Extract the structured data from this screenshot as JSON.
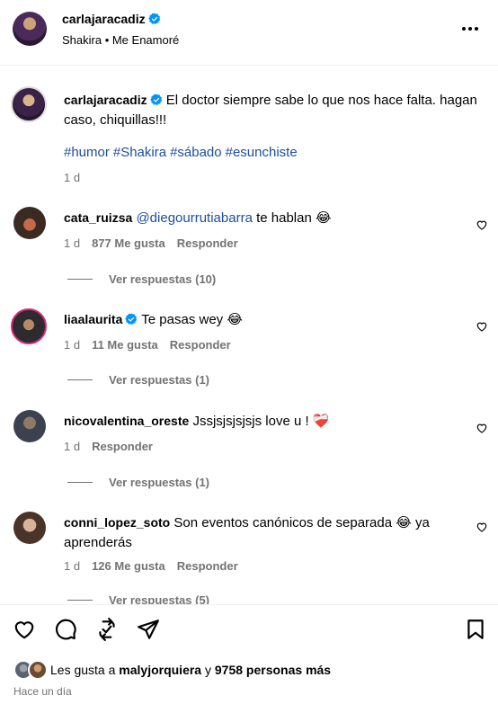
{
  "header": {
    "username": "carlajaracadiz",
    "song": "Shakira • Me Enamoré"
  },
  "caption": {
    "username": "carlajaracadiz",
    "text": "El doctor siempre sabe lo que nos hace falta. hagan caso, chiquillas!!!",
    "hashtags": [
      "#humor",
      "#Shakira",
      "#sábado",
      "#esunchiste"
    ],
    "time": "1 d"
  },
  "comments": [
    {
      "username": "cata_ruizsa",
      "mention": "@diegourrutiabarra",
      "text": "te hablan 😂",
      "time": "1 d",
      "likes": "877 Me gusta",
      "reply": "Responder",
      "view_replies": "Ver respuestas (10)"
    },
    {
      "username": "liaalaurita",
      "text": "Te pasas wey 😂",
      "time": "1 d",
      "likes": "11 Me gusta",
      "reply": "Responder",
      "view_replies": "Ver respuestas (1)"
    },
    {
      "username": "nicovalentina_oreste",
      "text": "Jssjsjsjsjsjs love u ! ❤️‍🩹",
      "time": "1 d",
      "reply": "Responder",
      "view_replies": "Ver respuestas (1)"
    },
    {
      "username": "conni_lopez_soto",
      "text": "Son eventos canónicos de separada 😂 ya aprenderás",
      "time": "1 d",
      "likes": "126 Me gusta",
      "reply": "Responder",
      "view_replies": "Ver respuestas (5)"
    }
  ],
  "footer": {
    "likes_prefix": "Les gusta a",
    "likes_user": "malyjorquiera",
    "likes_joiner": "y",
    "likes_others": "9758 personas más",
    "time": "Hace un día"
  },
  "icons": {
    "header_more": "more-options-icon",
    "actions": [
      "like-icon",
      "comment-icon",
      "repost-icon",
      "share-icon",
      "bookmark-icon"
    ],
    "verified": "verified-badge-icon"
  },
  "colors": {
    "link": "#1d4ea1",
    "muted": "#737373",
    "verified": "#0095f6"
  }
}
